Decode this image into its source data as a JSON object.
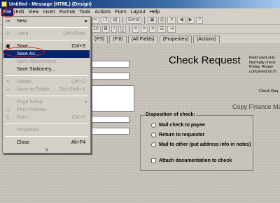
{
  "window": {
    "title": "Untitled - Message (HTML) (Design)"
  },
  "menubar": {
    "items": [
      "File",
      "Edit",
      "View",
      "Insert",
      "Format",
      "Tools",
      "Actions",
      "Form",
      "Layout",
      "Help"
    ]
  },
  "toolbar": {
    "send_label": "Send",
    "size_value": "10",
    "bold": "B",
    "italic": "I",
    "underline": "U",
    "send_right": "Send"
  },
  "tabs": [
    "(P.5)",
    "(P.6)",
    "(All Fields)",
    "(Properties)",
    "(Actions)"
  ],
  "file_menu": {
    "items": [
      {
        "label": "New",
        "shortcut": "",
        "state": "normal",
        "arrow": "▸"
      },
      {
        "label": "Send",
        "shortcut": "Ctrl+Enter",
        "state": "disabled"
      },
      {
        "label": "Save",
        "shortcut": "Ctrl+S",
        "state": "normal"
      },
      {
        "label": "Save As...",
        "shortcut": "",
        "state": "highlighted"
      },
      {
        "label": "Save Attachments...",
        "shortcut": "",
        "state": "disabled"
      },
      {
        "label": "Save Stationery...",
        "shortcut": "",
        "state": "normal"
      },
      {
        "label": "Delete",
        "shortcut": "Ctrl+D",
        "state": "disabled"
      },
      {
        "label": "Move to Folder...",
        "shortcut": "Ctrl+Shift+V",
        "state": "disabled"
      },
      {
        "label": "Page Setup",
        "shortcut": "",
        "state": "disabled",
        "arrow": "▸"
      },
      {
        "label": "Print Preview",
        "shortcut": "",
        "state": "disabled"
      },
      {
        "label": "Print...",
        "shortcut": "Ctrl+P",
        "state": "disabled"
      },
      {
        "label": "Properties",
        "shortcut": "",
        "state": "disabled"
      },
      {
        "label": "Close",
        "shortcut": "Alt+F4",
        "state": "normal"
      }
    ],
    "more": "»"
  },
  "form": {
    "title": "Check Request",
    "side_note": [
      "Field used only",
      "Normally check",
      "Friday.  Reque",
      "completed on th"
    ],
    "side_note_2": "Check Req",
    "copy_finance": "Copy Finance Ma"
  },
  "disposition": {
    "title": "Disposition of check:",
    "options": [
      "Mail check to payee",
      "Return to requestor",
      "Mail to other (put address info in notes)"
    ],
    "checkbox": "Attach documentation to check"
  },
  "colors": {
    "highlight": "#0a246a",
    "annotation_circle": "#e01010",
    "face": "#d4d0c8"
  }
}
